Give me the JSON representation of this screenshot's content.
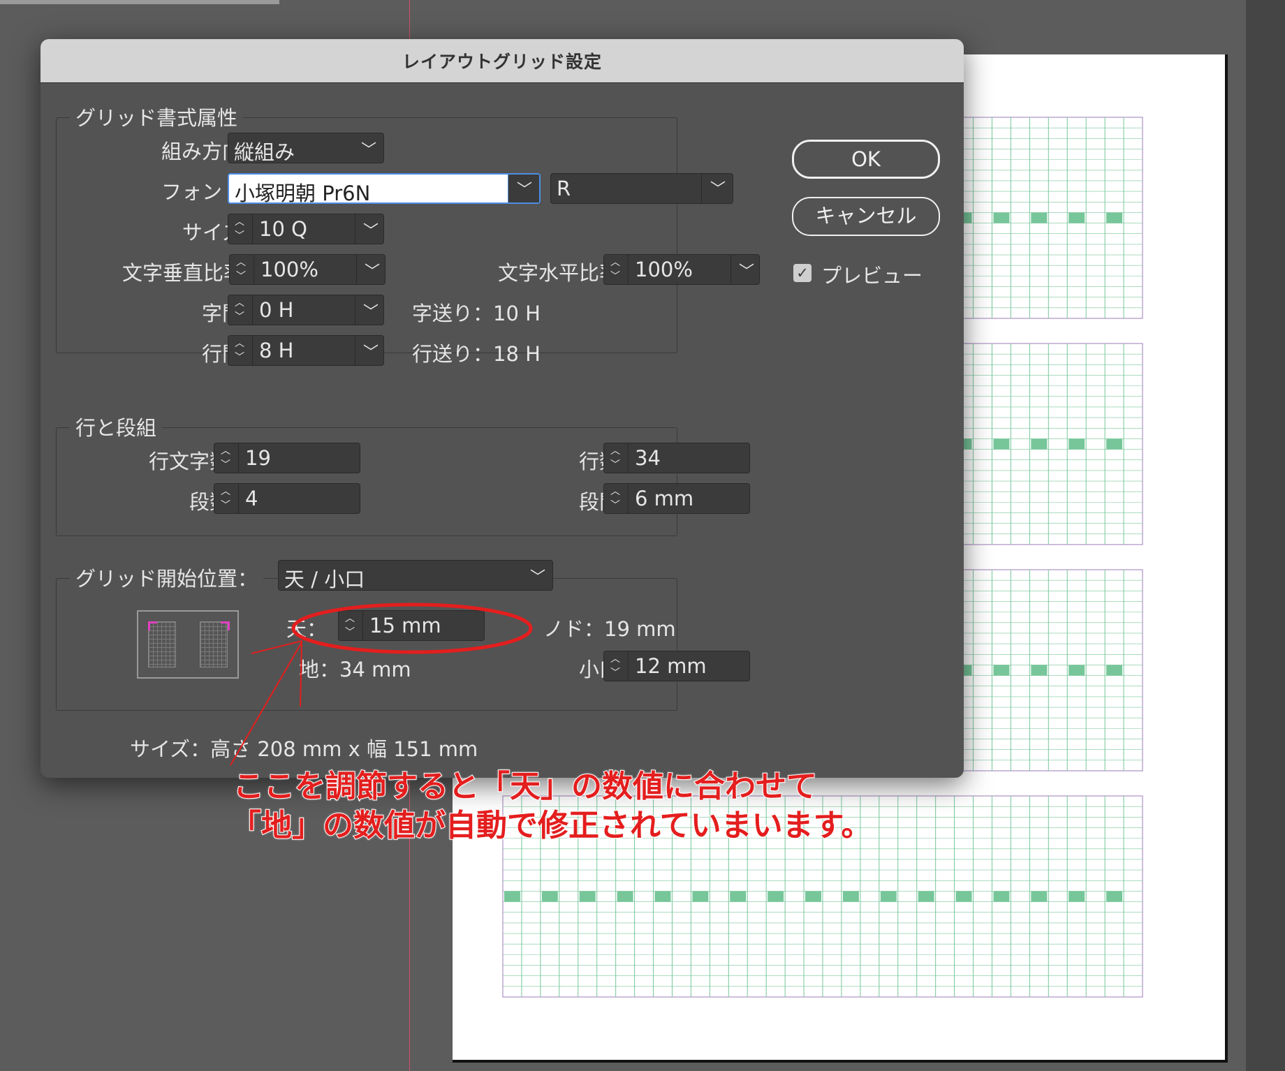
{
  "dialog": {
    "title": "レイアウトグリッド設定",
    "grid_format": {
      "legend": "グリッド書式属性",
      "direction": {
        "label": "組み方向：",
        "value": "縦組み"
      },
      "font": {
        "label": "フォント：",
        "family": "小塚明朝 Pr6N",
        "style": "R"
      },
      "size": {
        "label": "サイズ：",
        "value": "10 Q"
      },
      "vertical_scale": {
        "label": "文字垂直比率：",
        "value": "100%"
      },
      "horizontal_scale": {
        "label": "文字水平比率：",
        "value": "100%"
      },
      "char_spacing": {
        "label": "字間：",
        "value": "0 H"
      },
      "line_spacing": {
        "label": "行間：",
        "value": "8 H"
      },
      "char_advance": "字送り：10 H",
      "line_advance": "行送り：18 H"
    },
    "lines_columns": {
      "legend": "行と段組",
      "chars_per_line": {
        "label": "行文字数：",
        "value": "19"
      },
      "lines": {
        "label": "行数：",
        "value": "34"
      },
      "columns": {
        "label": "段数：",
        "value": "4"
      },
      "gutter": {
        "label": "段間：",
        "value": "6 mm"
      }
    },
    "start_position": {
      "legend": "グリッド開始位置：",
      "value": "天 / 小口",
      "top": {
        "label": "天：",
        "value": "15 mm"
      },
      "bottom_text": "地：34 mm",
      "inside_text": "ノド：19 mm",
      "outside": {
        "label": "小口：",
        "value": "12 mm"
      }
    },
    "size_text": "サイズ：高さ 208 mm x 幅 151 mm",
    "buttons": {
      "ok": "OK",
      "cancel": "キャンセル"
    },
    "preview": {
      "label": "プレビュー",
      "checked": true
    }
  },
  "annotation": {
    "line1": "ここを調節すると「天」の数値に合わせて",
    "line2": "「地」の数値が自動で修正されていまいます。",
    "color": "#e41e1e"
  },
  "colors": {
    "grid_line": "#77c69a",
    "grid_frame": "#9b7bb8",
    "accent": "#4d8ee8"
  }
}
